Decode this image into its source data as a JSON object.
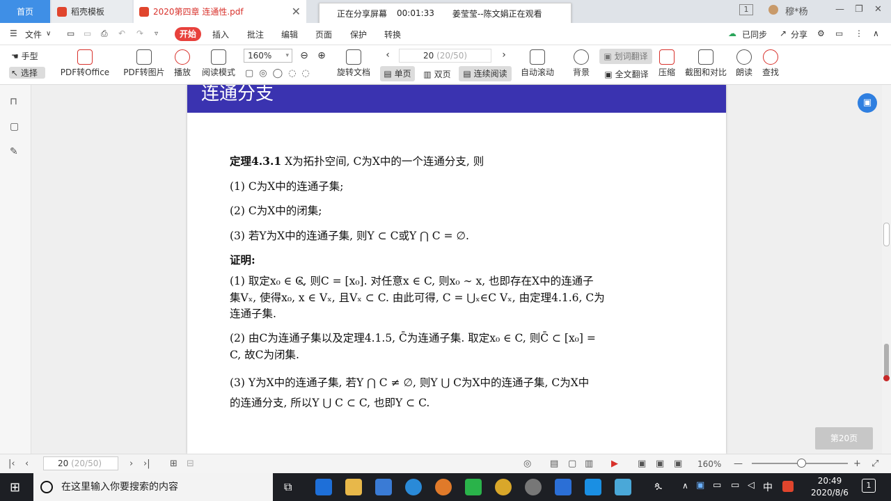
{
  "tabs": {
    "home": "首页",
    "template": "稻壳模板",
    "doc": "2020第四章 连通性.pdf"
  },
  "share_banner": {
    "status": "正在分享屏幕",
    "timer": "00:01:33",
    "viewers": "姜莹莹--陈文娟正在观看"
  },
  "window": {
    "badge": "1",
    "user": "穆*杨"
  },
  "menu": {
    "file": "文件",
    "start": "开始",
    "insert": "插入",
    "annotate": "批注",
    "edit": "编辑",
    "page": "页面",
    "protect": "保护",
    "convert": "转换",
    "synced": "已同步",
    "share": "分享"
  },
  "toolbar": {
    "hand": "手型",
    "select": "选择",
    "pdf_office": "PDF转Office",
    "pdf_image": "PDF转图片",
    "play": "播放",
    "read_mode": "阅读模式",
    "zoom": "160%",
    "rotate": "旋转文档",
    "page_input": "20",
    "page_total": "(20/50)",
    "single": "单页",
    "double": "双页",
    "continuous": "连续阅读",
    "autoscroll": "自动滚动",
    "background": "背景",
    "word_translate": "划词翻译",
    "full_translate": "全文翻译",
    "compress": "压缩",
    "screenshot": "截图和对比",
    "read_aloud": "朗读",
    "find": "查找"
  },
  "page": {
    "banner": "连通分支",
    "theorem_label": "定理4.3.1",
    "theorem_text": "X为拓扑空间, C为X中的一个连通分支, 则",
    "item1": "(1) C为X中的连通子集;",
    "item2": "(2) C为X中的闭集;",
    "item3": "(3) 若Y为X中的连通子集, 则Y ⊂ C或Y ⋂ C = ∅.",
    "proof_label": "证明:",
    "p1_l1": "(1) 取定x₀ ∈ C, 则C = [x₀]. 对任意x ∈ C, 则x₀ ∼ x, 也即存在X中的连通子",
    "p1_l2": "集Vₓ, 使得x₀, x ∈ Vₓ, 且Vₓ ⊂ C. 由此可得, C = ⋃ₓ∈C Vₓ, 由定理4.1.6, C为",
    "p1_l3": "连通子集.",
    "p2_l1": "(2) 由C为连通子集以及定理4.1.5, C̄为连通子集. 取定x₀ ∈ C, 则C̄ ⊂ [x₀] =",
    "p2_l2": "C, 故C为闭集.",
    "p3_l1": "(3) Y为X中的连通子集, 若Y ⋂ C ≠ ∅, 则Y ⋃ C为X中的连通子集, C为X中",
    "p3_l2": "的连通分支, 所以Y ⋃ C ⊂ C, 也即Y ⊂ C."
  },
  "page_badge": "第20页",
  "status": {
    "page": "20",
    "page_total": "(20/50)",
    "zoom": "160%"
  },
  "taskbar": {
    "search_placeholder": "在这里输入你要搜索的内容",
    "ime": "中",
    "time": "20:49",
    "date": "2020/8/6",
    "notif_count": "1"
  }
}
